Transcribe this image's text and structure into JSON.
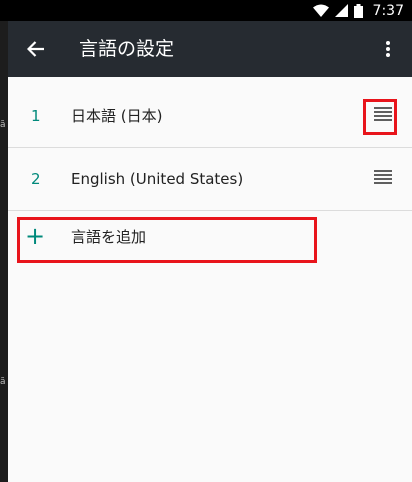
{
  "status_bar": {
    "time": "7:37",
    "icons": [
      "wifi-icon",
      "signal-icon",
      "battery-icon"
    ]
  },
  "toolbar": {
    "title": "言語の設定",
    "back_icon": "arrow-back-icon",
    "more_icon": "more-vert-icon"
  },
  "languages": [
    {
      "number": "1",
      "name": "日本語 (日本)"
    },
    {
      "number": "2",
      "name": "English (United States)"
    }
  ],
  "add_language": {
    "label": "言語を追加",
    "icon": "plus-icon"
  },
  "colors": {
    "accent": "#00897b",
    "toolbar": "#262b31",
    "highlight": "#e8141b",
    "background": "#fafafa"
  }
}
